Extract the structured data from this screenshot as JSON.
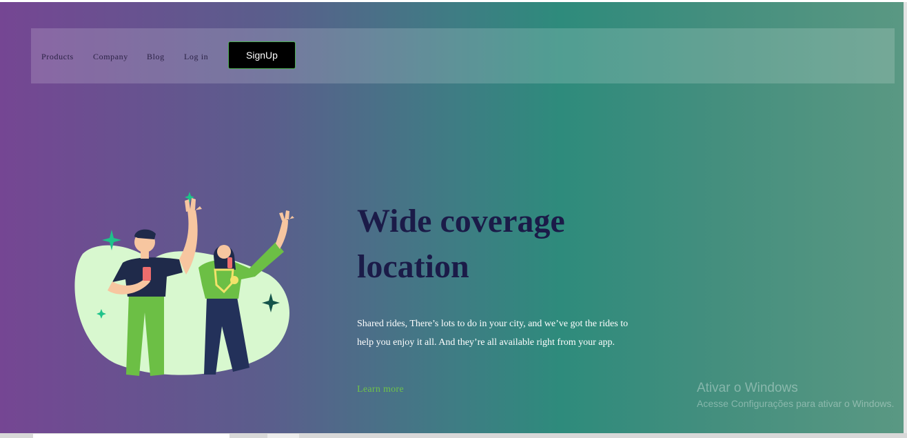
{
  "nav": {
    "items": [
      {
        "label": "Products"
      },
      {
        "label": "Company"
      },
      {
        "label": "Blog"
      },
      {
        "label": "Log in"
      }
    ],
    "signup_label": "SignUp"
  },
  "hero": {
    "title": "Wide coverage location",
    "description": "Shared rides, There’s lots to do in your city, and we’ve got the rides to help you enjoy it all. And they’re all available right from your app.",
    "learn_more": "Learn more"
  },
  "windows_watermark": {
    "title": "Ativar o Windows",
    "subtitle": "Acesse Configurações para ativar o Windows."
  },
  "colors": {
    "gradient_start": "#754693",
    "gradient_mid": "#2e8b7c",
    "gradient_end": "#5a9883",
    "heading": "#1b1b48",
    "accent_green": "#6fc24a",
    "button_bg": "#000000"
  },
  "icons": [
    "sparkle-icon"
  ]
}
